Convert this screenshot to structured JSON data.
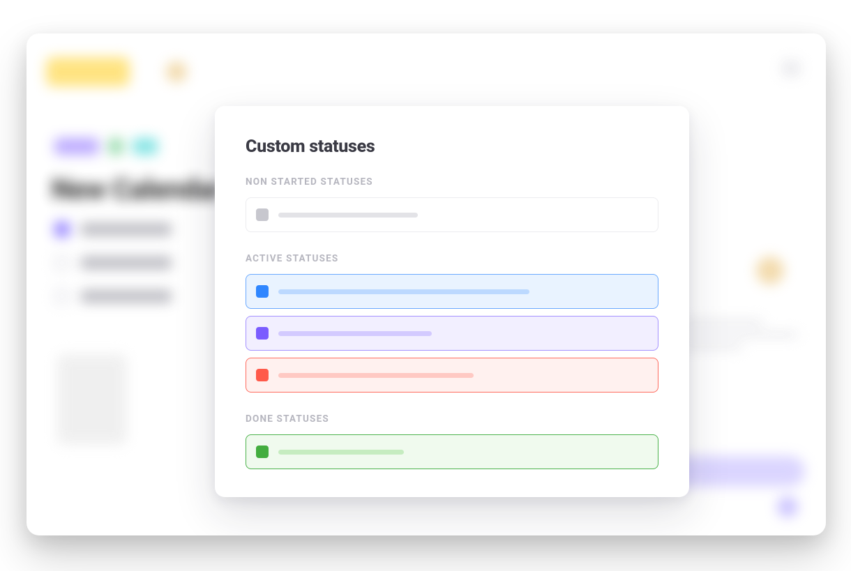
{
  "modal": {
    "title": "Custom statuses",
    "groups": [
      {
        "key": "non_started",
        "label": "NON STARTED STATUSES",
        "items": [
          {
            "color": "gray",
            "swatch_hex": "#c7c7ce",
            "border_hex": "#ececef",
            "fill_hex": "#ffffff"
          }
        ]
      },
      {
        "key": "active",
        "label": "ACTIVE STATUSES",
        "items": [
          {
            "color": "blue",
            "swatch_hex": "#2f86ff",
            "border_hex": "#6aa9ff",
            "fill_hex": "#e9f3ff"
          },
          {
            "color": "purple",
            "swatch_hex": "#7a5cff",
            "border_hex": "#a491ff",
            "fill_hex": "#f2efff"
          },
          {
            "color": "red",
            "swatch_hex": "#ff5a4a",
            "border_hex": "#ff6b5e",
            "fill_hex": "#fff1ef"
          }
        ]
      },
      {
        "key": "done",
        "label": "DONE STATUSES",
        "items": [
          {
            "color": "green",
            "swatch_hex": "#43ad3f",
            "border_hex": "#4cb24c",
            "fill_hex": "#f0faee"
          }
        ]
      }
    ]
  },
  "background": {
    "page_title": "New Calendar"
  }
}
